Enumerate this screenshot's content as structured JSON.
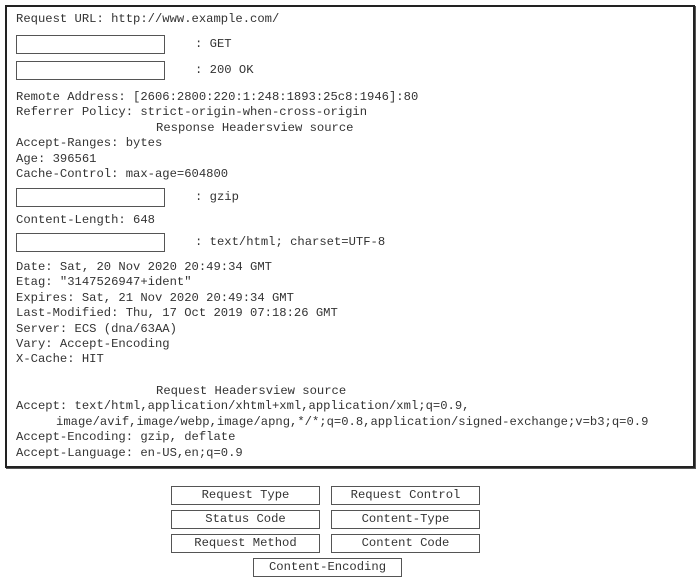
{
  "general": {
    "request_url": "Request URL: http://www.example.com/",
    "blank1_value": ": GET",
    "blank2_value": ": 200 OK",
    "remote_address": "Remote Address: [2606:2800:220:1:248:1893:25c8:1946]:80",
    "referrer_policy": "Referrer Policy: strict-origin-when-cross-origin"
  },
  "response_headers": {
    "title": "Response Headersview source",
    "accept_ranges": "Accept-Ranges: bytes",
    "age": "Age: 396561",
    "cache_control": "Cache-Control: max-age=604800",
    "blank3_value": ": gzip",
    "content_length": "Content-Length: 648",
    "blank4_value": ": text/html; charset=UTF-8",
    "date": "Date: Sat, 20 Nov 2020 20:49:34 GMT",
    "etag": "Etag: \"3147526947+ident\"",
    "expires": "Expires: Sat, 21 Nov 2020 20:49:34 GMT",
    "last_modified": "Last-Modified: Thu, 17 Oct 2019 07:18:26 GMT",
    "server": "Server: ECS (dna/63AA)",
    "vary": "Vary: Accept-Encoding",
    "x_cache": "X-Cache: HIT"
  },
  "request_headers": {
    "title": "Request Headersview source",
    "accept_line1": "Accept: text/html,application/xhtml+xml,application/xml;q=0.9,",
    "accept_line2": "image/avif,image/webp,image/apng,*/*;q=0.8,application/signed-exchange;v=b3;q=0.9",
    "accept_encoding": "Accept-Encoding: gzip, deflate",
    "accept_language": "Accept-Language: en-US,en;q=0.9"
  },
  "options": [
    {
      "label": "Request Type"
    },
    {
      "label": "Request Control"
    },
    {
      "label": "Status Code"
    },
    {
      "label": "Content-Type"
    },
    {
      "label": "Request Method"
    },
    {
      "label": "Content Code"
    },
    {
      "label": "Content-Encoding"
    }
  ]
}
